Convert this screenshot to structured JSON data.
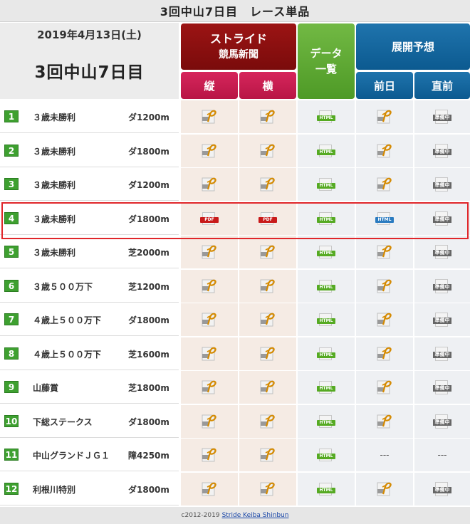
{
  "page_title": "3回中山7日目　レース単品",
  "date": "2019年4月13日(土)",
  "meeting": "3回中山7日目",
  "headers": {
    "stride_line1": "ストライド",
    "stride_line2": "競馬新聞",
    "tate": "縦",
    "yoko": "横",
    "data_line1": "データ",
    "data_line2": "一覧",
    "tenkai": "展開予想",
    "zenjitsu": "前日",
    "chokuzen": "直前"
  },
  "icon_labels": {
    "html": "HTML",
    "pdf": "PDF",
    "junbi": "準備中",
    "dash": "---"
  },
  "races": [
    {
      "no": "1",
      "name": "３歳未勝利",
      "dist": "ダ1200m",
      "tate": "p",
      "yoko": "p",
      "data": "html-green",
      "zen": "p",
      "choku": "junbi"
    },
    {
      "no": "2",
      "name": "３歳未勝利",
      "dist": "ダ1800m",
      "tate": "p",
      "yoko": "p",
      "data": "html-green",
      "zen": "p",
      "choku": "junbi"
    },
    {
      "no": "3",
      "name": "３歳未勝利",
      "dist": "ダ1200m",
      "tate": "p",
      "yoko": "p",
      "data": "html-green",
      "zen": "p",
      "choku": "junbi"
    },
    {
      "no": "4",
      "name": "３歳未勝利",
      "dist": "ダ1800m",
      "tate": "pdf",
      "yoko": "pdf",
      "data": "html-green",
      "zen": "html-blue",
      "choku": "junbi"
    },
    {
      "no": "5",
      "name": "３歳未勝利",
      "dist": "芝2000m",
      "tate": "p",
      "yoko": "p",
      "data": "html-green",
      "zen": "p",
      "choku": "junbi"
    },
    {
      "no": "6",
      "name": "３歳５００万下",
      "dist": "芝1200m",
      "tate": "p",
      "yoko": "p",
      "data": "html-green",
      "zen": "p",
      "choku": "junbi"
    },
    {
      "no": "7",
      "name": "４歳上５００万下",
      "dist": "ダ1800m",
      "tate": "p",
      "yoko": "p",
      "data": "html-green",
      "zen": "p",
      "choku": "junbi"
    },
    {
      "no": "8",
      "name": "４歳上５００万下",
      "dist": "芝1600m",
      "tate": "p",
      "yoko": "p",
      "data": "html-green",
      "zen": "p",
      "choku": "junbi"
    },
    {
      "no": "9",
      "name": "山藤賞",
      "dist": "芝1800m",
      "tate": "p",
      "yoko": "p",
      "data": "html-green",
      "zen": "p",
      "choku": "junbi"
    },
    {
      "no": "10",
      "name": "下総ステークス",
      "dist": "ダ1800m",
      "tate": "p",
      "yoko": "p",
      "data": "html-green",
      "zen": "p",
      "choku": "junbi"
    },
    {
      "no": "11",
      "name": "中山グランドＪＧ１",
      "dist": "障4250m",
      "tate": "p",
      "yoko": "p",
      "data": "html-green",
      "zen": "dash",
      "choku": "dash"
    },
    {
      "no": "12",
      "name": "利根川特別",
      "dist": "ダ1800m",
      "tate": "p",
      "yoko": "p",
      "data": "html-green",
      "zen": "p",
      "choku": "junbi"
    }
  ],
  "footer": {
    "copyright": "c2012-2019",
    "link": "Stride Keiba Shinbun"
  },
  "colors": {
    "accent_red": "#9c1414",
    "pink": "#d6265c",
    "green": "#4e9a26",
    "blue": "#0c5a90",
    "highlight": "#e0262a"
  }
}
